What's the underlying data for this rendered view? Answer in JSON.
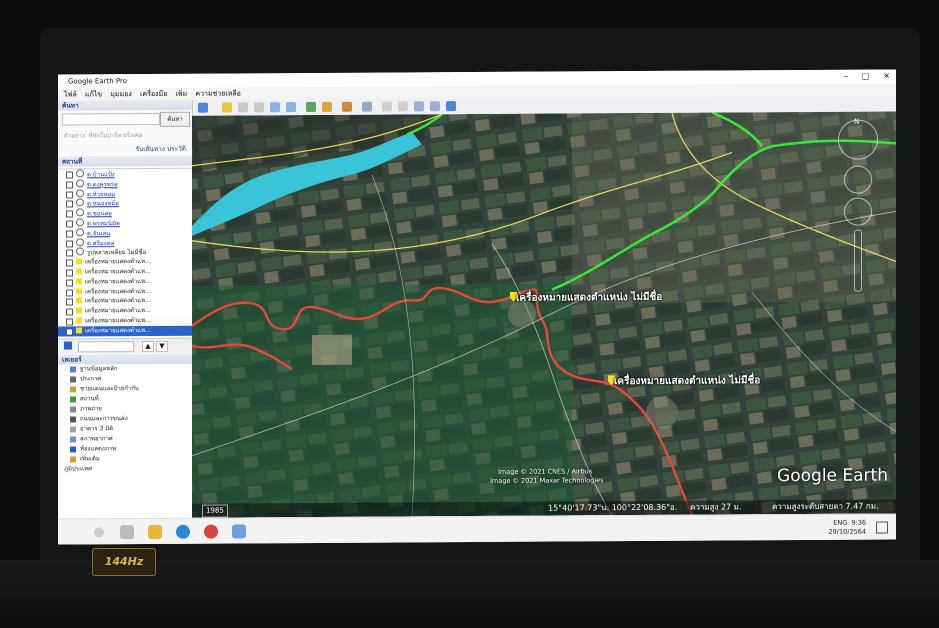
{
  "window": {
    "title": "Google Earth Pro",
    "buttons": [
      "–",
      "□",
      "✕"
    ]
  },
  "menu": [
    "ไฟล์",
    "แก้ไข",
    "มุมมอง",
    "เครื่องมือ",
    "เพิ่ม",
    "ความช่วยเหลือ"
  ],
  "search": {
    "header": "ค้นหา",
    "button": "ค้นหา",
    "hint": "ตัวอย่าง: ที่พักในปารีส ฝรั่งเศส",
    "links": "รับเส้นทาง    ประวัติ"
  },
  "places": {
    "header": "สถานที่",
    "items": [
      "ต.บ้านแป้ง",
      "ต.ดงคู่รพรส",
      "ต.ห้วยหอม",
      "ต.หนองหม้อ",
      "ต.ชอนลอ",
      "ต.พรหมนิมิต",
      "ต.จันเสน",
      "ต.ศรีมงคล",
      "รูปหลายเหลี่ยม ไม่มีชื่อ",
      "เครื่องหมายแสดงตำแห...",
      "เครื่องหมายแสดงตำแห...",
      "เครื่องหมายแสดงตำแห...",
      "เครื่องหมายแสดงตำแห...",
      "เครื่องหมายแสดงตำแห...",
      "เครื่องหมายแสดงตำแห...",
      "เครื่องหมายแสดงตำแห...",
      "เครื่องหมายแสดงตำแห..."
    ]
  },
  "layers": {
    "header": "เลเยอร์",
    "items": [
      "ฐานข้อมูลหลัก",
      "ประกาศ",
      "ชายแดนและป้ายกำกับ",
      "สถานที่",
      "ภาพถ่าย",
      "ถนนและการขนส่ง",
      "อาคาร 3 มิติ",
      "สภาพอากาศ",
      "ห้องแสดงภาพ",
      "เพิ่มเติม",
      "ภูมิประเทศ"
    ]
  },
  "map": {
    "placemark1": "เครื่องหมายแสดงตำแหน่ง ไม่มีชื่อ",
    "placemark2": "เครื่องหมายแสดงตำแหน่ง ไม่มีชื่อ",
    "credit1": "Image © 2021 CNES / Airbus",
    "credit2": "Image © 2021 Maxar Technologies",
    "logo": "Google Earth",
    "compass_n": "N",
    "colors": {
      "river": "#e8473a",
      "boundary_green": "#38e838",
      "boundary_yellow": "#e8e060",
      "water": "#3ac4d8"
    }
  },
  "status": {
    "year": "1985",
    "coords": "15°40'17.73\"น.   100°22'08.36\"อ.",
    "elevation": "ความสูง    27 ม.",
    "eye_alt": "ความสูงระดับสายตา    7.47 กม."
  },
  "tray": {
    "lang": "ENG",
    "time": "9:36",
    "date": "29/10/2564"
  },
  "sticker": "144Hz"
}
